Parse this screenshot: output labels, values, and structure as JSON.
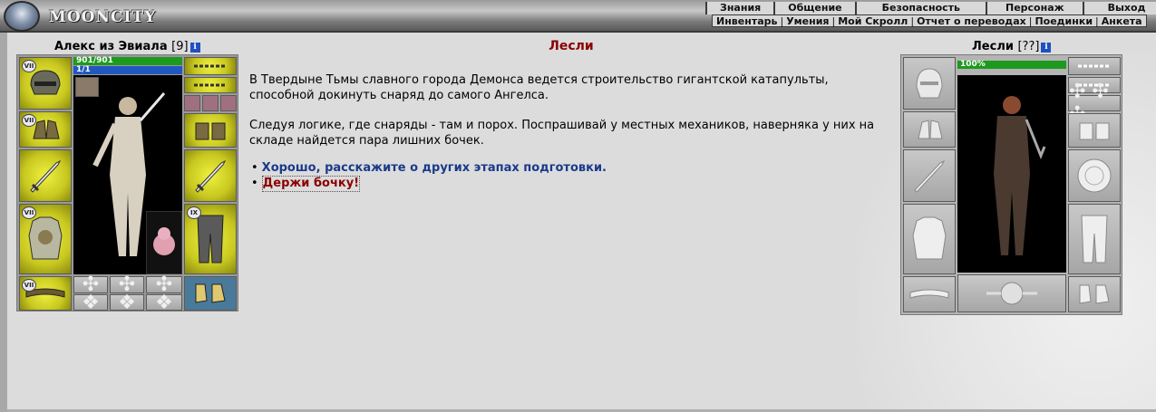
{
  "header": {
    "logo_text": "MOONCITY",
    "menu_main": [
      "Знания",
      "Общение",
      "Безопасность",
      "Персонаж",
      "Выход"
    ],
    "menu_sub": [
      "Инвентарь",
      "Умения",
      "Мой Скролл",
      "Отчет о переводах",
      "Поединки",
      "Анкета"
    ]
  },
  "player": {
    "name": "Алекс из Эвиала",
    "level": "[9]",
    "hp": "901/901",
    "mp": "1/1",
    "badges": [
      "VII",
      "VII",
      "VII",
      "VII",
      "IX"
    ]
  },
  "npc": {
    "name": "Лесли",
    "level": "[??]",
    "hp": "100%"
  },
  "dialog": {
    "title": "Лесли",
    "paragraph1": "В Твердыне Тьмы славного города Демонса ведется строительство гигантской катапульты, способной докинуть снаряд до самого Ангелса.",
    "paragraph2": "Следуя логике, где снаряды - там и порох. Поспрашивай у местных механиков, наверняка у них на складе найдется пара лишних бочек.",
    "bullet": "•",
    "answers": [
      "Хорошо, расскажите о других этапах подготовки.",
      "Держи бочку!"
    ]
  },
  "info_icon_label": "i",
  "colors": {
    "npc_title": "#8b0000",
    "answer_link": "#1a3a8a",
    "answer_accept": "#8b0000",
    "hp_bar": "#1d9a1d",
    "mp_bar": "#2058c0"
  }
}
